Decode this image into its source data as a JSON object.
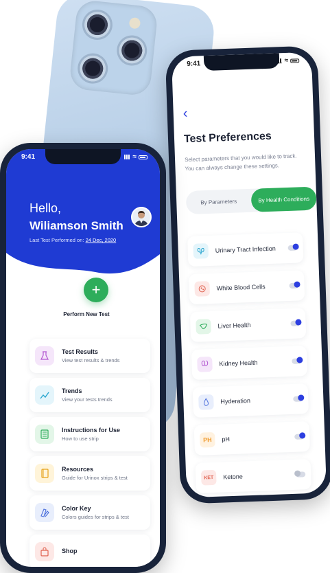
{
  "right_screen": {
    "status_time": "9:41",
    "title": "Test Preferences",
    "description": "Select parameters that you would like to track. You can always change these settings.",
    "segments": [
      "By Parameters",
      "By Health Conditions"
    ],
    "active_segment": "By Health Conditions",
    "conditions": [
      {
        "label": "Urinary Tract Infection",
        "icon": "kidneys-icon",
        "icon_text": "",
        "enabled": true
      },
      {
        "label": "White Blood Cells",
        "icon": "cell-icon",
        "icon_text": "",
        "enabled": true
      },
      {
        "label": "Liver Health",
        "icon": "liver-icon",
        "icon_text": "",
        "enabled": true
      },
      {
        "label": "Kidney Health",
        "icon": "kidney-icon",
        "icon_text": "",
        "enabled": true
      },
      {
        "label": "Hyderation",
        "icon": "droplet-icon",
        "icon_text": "",
        "enabled": true
      },
      {
        "label": "pH",
        "icon": "ph-icon",
        "icon_text": "PH",
        "enabled": true
      },
      {
        "label": "Ketone",
        "icon": "ketone-icon",
        "icon_text": "KET",
        "enabled": false
      }
    ]
  },
  "left_screen": {
    "status_time": "9:41",
    "greeting": "Hello,",
    "user_name": "Wiliamson Smith",
    "last_test_prefix": "Last Test Performed on:",
    "last_test_date": "24 Dec, 2020",
    "perform_label": "Perform New Test",
    "menu": [
      {
        "title": "Test Results",
        "subtitle": "View test results & trends",
        "icon": "flask-icon"
      },
      {
        "title": "Trends",
        "subtitle": "View your tests trends",
        "icon": "trend-icon"
      },
      {
        "title": "Instructions for Use",
        "subtitle": "How to use strip",
        "icon": "strip-icon"
      },
      {
        "title": "Resources",
        "subtitle": "Guide for Urinox strips & test",
        "icon": "book-icon"
      },
      {
        "title": "Color Key",
        "subtitle": "Colors guides for strips & test",
        "icon": "palette-icon"
      },
      {
        "title": "Shop",
        "subtitle": "",
        "icon": "bag-icon"
      }
    ]
  },
  "colors": {
    "brand_blue": "#1f3bd3",
    "accent_green": "#2dad5b"
  }
}
